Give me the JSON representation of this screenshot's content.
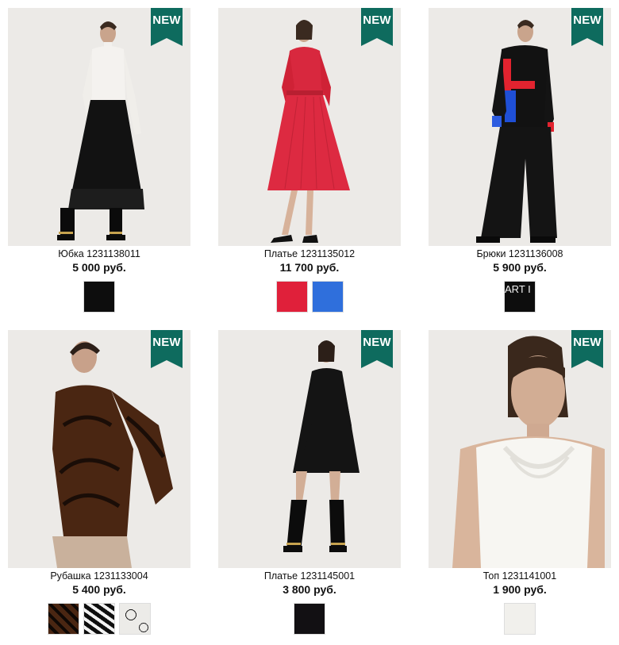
{
  "badge_label": "NEW",
  "colors": {
    "badge": "#0e6b5e",
    "photo_bg": "#eceae7"
  },
  "products": [
    {
      "title": "Юбка 1231138011",
      "price": "5 000 руб.",
      "new": true,
      "swatches": [
        "black"
      ]
    },
    {
      "title": "Платье 1231135012",
      "price": "11 700 руб.",
      "new": true,
      "swatches": [
        "red",
        "blue"
      ]
    },
    {
      "title": "Брюки 1231136008",
      "price": "5 900 руб.",
      "new": true,
      "swatches": [
        "black-print"
      ]
    },
    {
      "title": "Рубашка 1231133004",
      "price": "5 400 руб.",
      "new": true,
      "swatches": [
        "brown-zebra",
        "black-white-zebra",
        "white-circles"
      ]
    },
    {
      "title": "Платье 1231145001",
      "price": "3 800 руб.",
      "new": true,
      "swatches": [
        "black"
      ]
    },
    {
      "title": "Топ 1231141001",
      "price": "1 900 руб.",
      "new": true,
      "swatches": [
        "white"
      ]
    }
  ],
  "swatch_print_text": "ART I"
}
